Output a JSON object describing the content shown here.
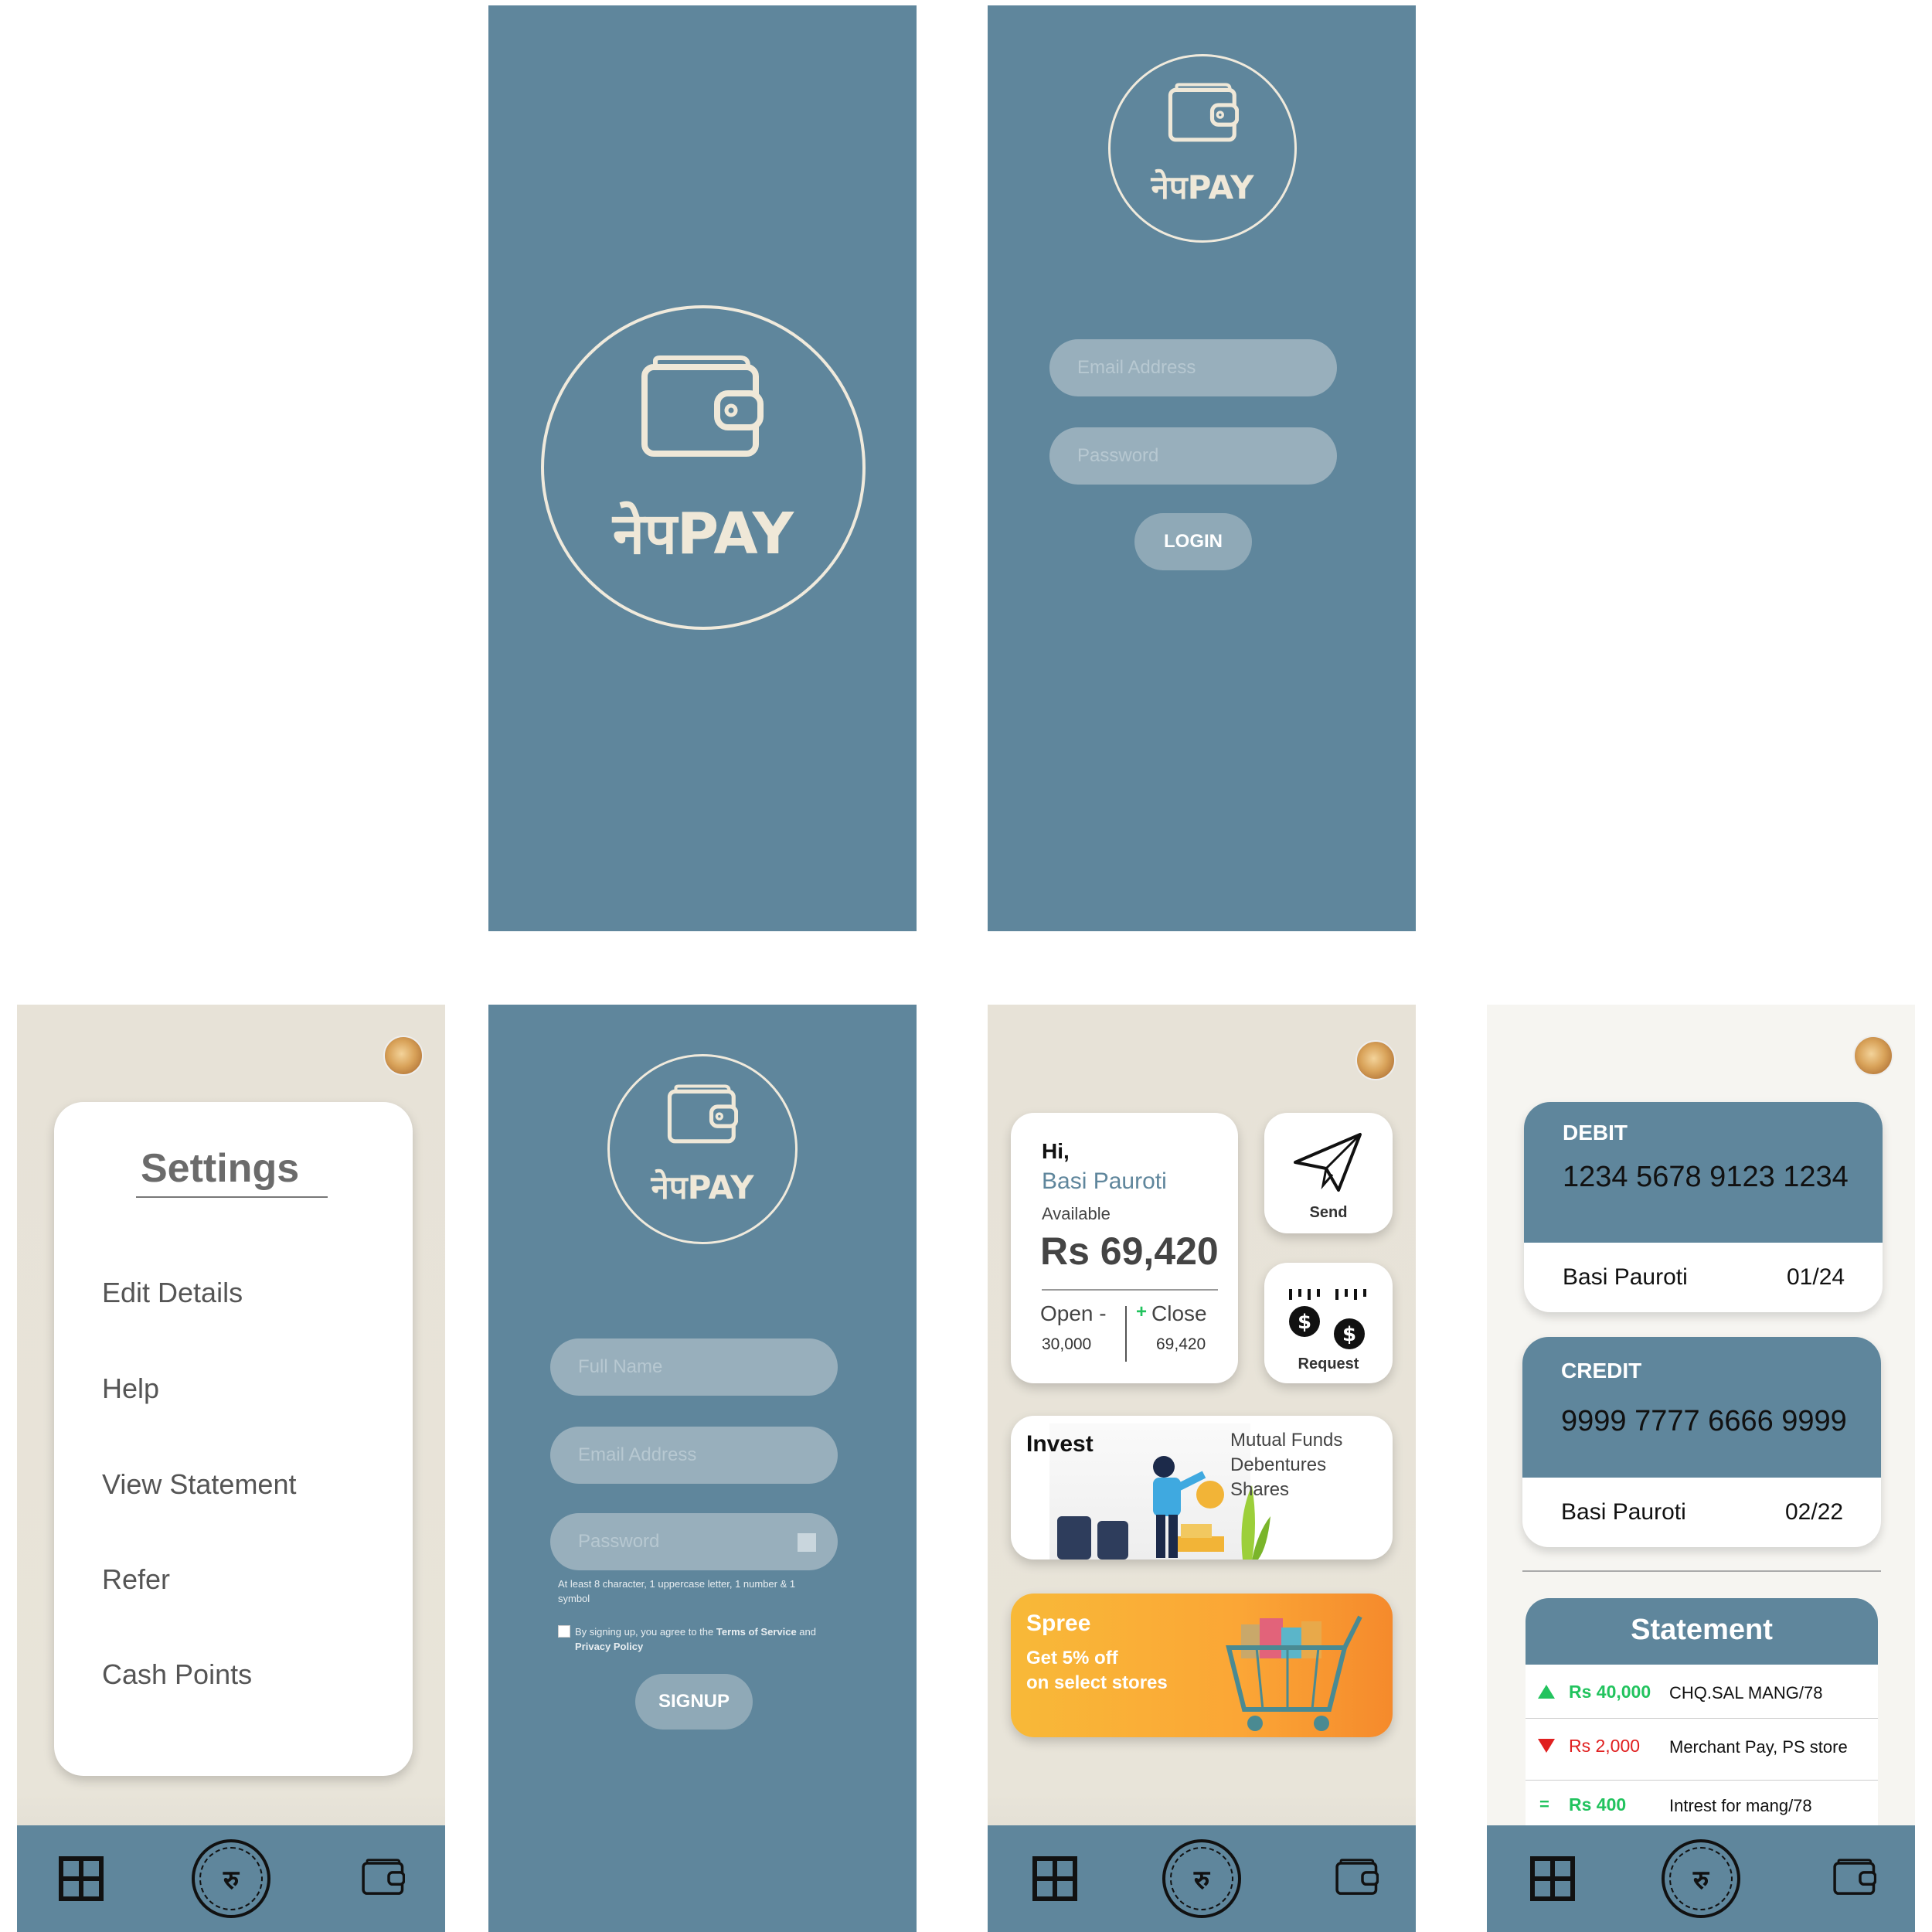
{
  "brand": {
    "name": "नेपPAY"
  },
  "login": {
    "email_placeholder": "Email Address",
    "password_placeholder": "Password",
    "login_label": "LOGIN"
  },
  "settings": {
    "title": "Settings",
    "items": [
      "Edit Details",
      "Help",
      "View Statement",
      "Refer",
      "Cash Points"
    ]
  },
  "signup": {
    "fullname_placeholder": "Full Name",
    "email_placeholder": "Email Address",
    "password_placeholder": "Password",
    "password_hint": "At least 8 character, 1 uppercase letter, 1 number & 1 symbol",
    "terms_prefix": "By signing up, you agree to the",
    "terms_link": "Terms of Service",
    "terms_and": "and",
    "privacy_link": "Privacy Policy",
    "signup_label": "SIGNUP"
  },
  "home": {
    "greeting": "Hi,",
    "user_name": "Basi Pauroti",
    "available_label": "Available",
    "balance": "Rs 69,420",
    "open_label": "Open -",
    "open_value": "30,000",
    "close_label": "Close",
    "close_value": "69,420",
    "send_label": "Send",
    "request_label": "Request",
    "invest_label": "Invest",
    "invest_items": [
      "Mutual Funds",
      "Debentures",
      "Shares"
    ],
    "spree_title": "Spree",
    "spree_line1": "Get 5% off",
    "spree_line2": "on select stores"
  },
  "cards": {
    "debit": {
      "type": "DEBIT",
      "number": "1234 5678 9123 1234",
      "holder": "Basi Pauroti",
      "expiry": "01/24"
    },
    "credit": {
      "type": "CREDIT",
      "number": "9999 7777 6666 9999",
      "holder": "Basi Pauroti",
      "expiry": "02/22"
    },
    "statement_title": "Statement",
    "transactions": [
      {
        "direction": "up",
        "amount": "Rs 40,000",
        "description": "CHQ.SAL MANG/78",
        "color": "#22c35e"
      },
      {
        "direction": "down",
        "amount": "Rs 2,000",
        "description": "Merchant Pay, PS store",
        "color": "#e02020"
      },
      {
        "direction": "equal",
        "amount": "Rs 400",
        "description": "Intrest for mang/78",
        "color": "#22c35e"
      }
    ]
  },
  "nav": {
    "currency_glyph": "रु",
    "icons": [
      "grid-icon",
      "rupee-coin-icon",
      "wallet-icon"
    ]
  },
  "colors": {
    "primary": "#5f869c",
    "beige": "#e7e2d7",
    "cream": "#efe8d8",
    "green": "#22c35e",
    "red": "#e02020"
  }
}
